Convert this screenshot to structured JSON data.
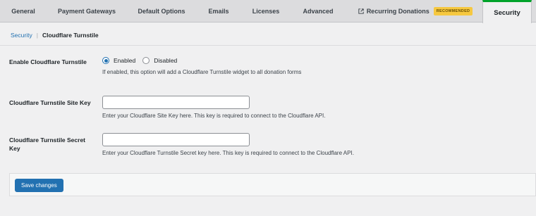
{
  "tabs": [
    {
      "label": "General"
    },
    {
      "label": "Payment Gateways"
    },
    {
      "label": "Default Options"
    },
    {
      "label": "Emails"
    },
    {
      "label": "Licenses"
    },
    {
      "label": "Advanced"
    },
    {
      "label": "Recurring Donations",
      "icon": "external-link-icon",
      "badge": "RECOMMENDED"
    },
    {
      "label": "Security",
      "active": true
    }
  ],
  "breadcrumb": {
    "parent": "Security",
    "current": "Cloudflare Turnstile"
  },
  "settings": {
    "enable": {
      "label": "Enable Cloudflare Turnstile",
      "options": [
        "Enabled",
        "Disabled"
      ],
      "selected": "Enabled",
      "description": "If enabled, this option will add a Cloudflare Turnstile widget to all donation forms"
    },
    "site_key": {
      "label": "Cloudflare Turnstile Site Key",
      "value": "",
      "description": "Enter your Cloudflare Site Key here. This key is required to connect to the Cloudflare API."
    },
    "secret_key": {
      "label": "Cloudflare Turnstile Secret Key",
      "value": "",
      "description": "Enter your Cloudflare Turnstile Secret key here. This key is required to connect to the Cloudflare API."
    }
  },
  "save_label": "Save changes",
  "colors": {
    "primary": "#2271b1",
    "active_tab_accent": "#00a32a",
    "badge_bg": "#f6c840"
  }
}
